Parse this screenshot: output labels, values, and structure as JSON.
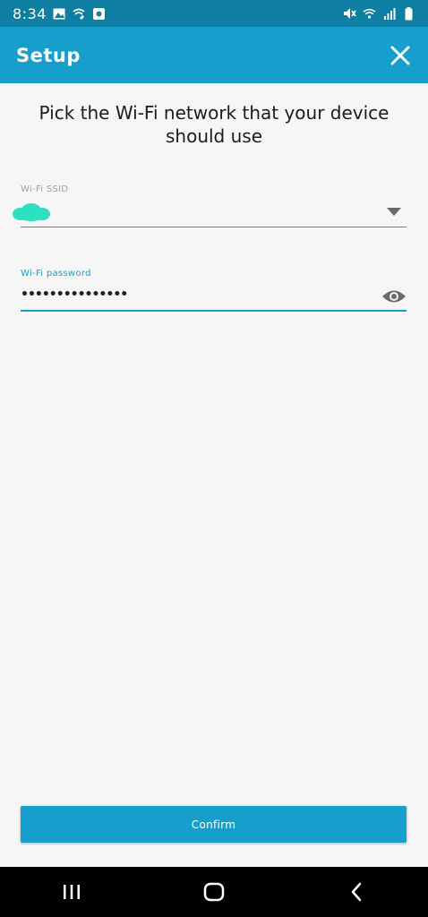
{
  "status_bar": {
    "time": "8:34",
    "left_icons": [
      "image-icon",
      "wifi-calling-icon",
      "app-notification-icon"
    ],
    "right_icons": [
      "mute-icon",
      "wifi-icon",
      "signal-icon",
      "battery-icon"
    ]
  },
  "app_bar": {
    "title": "Setup",
    "close_icon": "close-icon"
  },
  "main": {
    "heading": "Pick the Wi-Fi network that your device should use",
    "ssid": {
      "label": "Wi-Fi SSID",
      "value": "",
      "dropdown_icon": "chevron-down-icon"
    },
    "password": {
      "label": "Wi-Fi password",
      "value": "•••••••••••••••",
      "visibility_icon": "eye-icon"
    },
    "confirm_label": "Confirm"
  },
  "nav_bar": {
    "buttons": [
      "recent-apps-icon",
      "home-icon",
      "back-icon"
    ]
  },
  "colors": {
    "status_bar": "#0e7fa2",
    "app_bar": "#169fcd",
    "accent": "#169fcd",
    "background": "#f6f6f6",
    "redaction": "#2de0c0"
  }
}
